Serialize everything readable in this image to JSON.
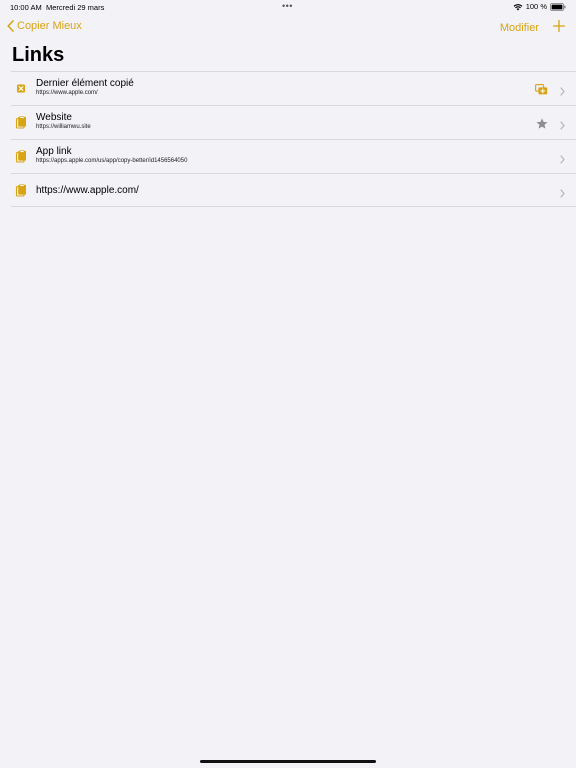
{
  "status_bar": {
    "time": "10:00 AM",
    "date": "Mercredi 29 mars",
    "battery": "100 %"
  },
  "nav": {
    "back_label": "Copier Mieux",
    "edit_label": "Modifier"
  },
  "page_title": "Links",
  "accent_color": "#d9a414",
  "rows": [
    {
      "title": "Dernier élément copié",
      "subtitle": "https://www.apple.com/",
      "lead_icon": "clipboard-x-icon",
      "trail_icon": "copy-stack-icon"
    },
    {
      "title": "Website",
      "subtitle": "https://williamwu.site",
      "lead_icon": "clipboard-icon",
      "trail_icon": "star-icon"
    },
    {
      "title": "App link",
      "subtitle": "https://apps.apple.com/us/app/copy-better/id1456564050",
      "lead_icon": "clipboard-icon",
      "trail_icon": ""
    },
    {
      "title": "https://www.apple.com/",
      "subtitle": "",
      "lead_icon": "clipboard-icon",
      "trail_icon": ""
    }
  ]
}
